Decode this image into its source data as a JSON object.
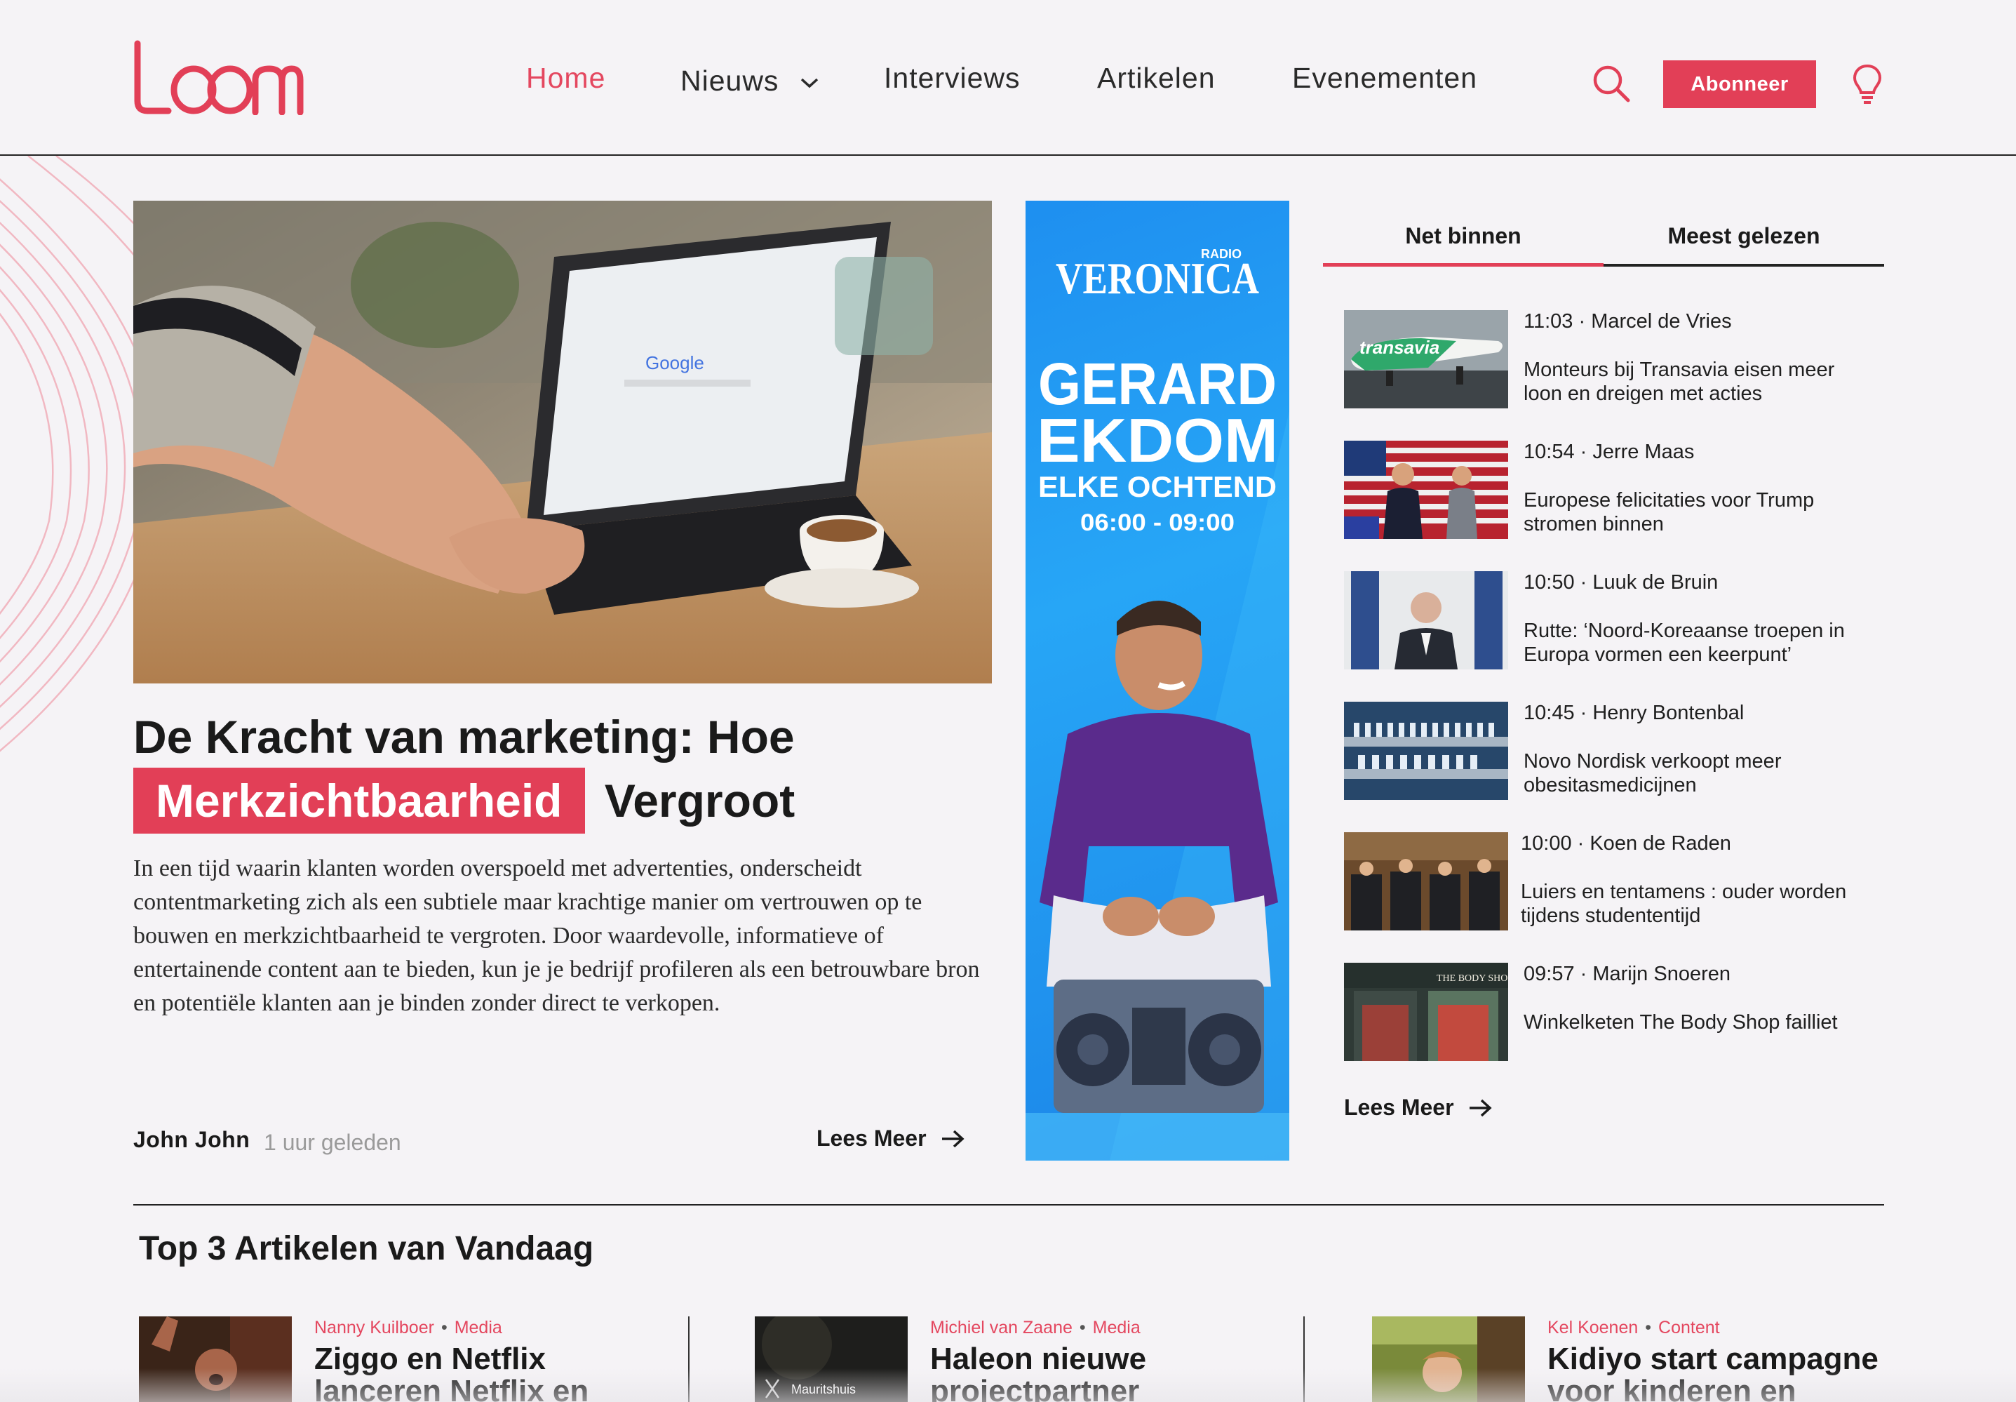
{
  "brand": {
    "name": "loom",
    "accent": "#e23f57"
  },
  "nav": {
    "items": [
      {
        "label": "Home",
        "active": true
      },
      {
        "label": "Nieuws",
        "dropdown": true
      },
      {
        "label": "Interviews"
      },
      {
        "label": "Artikelen"
      },
      {
        "label": "Evenementen"
      }
    ],
    "subscribe_label": "Abonneer",
    "icons": [
      "search-icon",
      "lightbulb-icon"
    ]
  },
  "hero": {
    "image": "laptop-google-coffee-photo",
    "title_part1": "De Kracht van marketing: Hoe",
    "title_highlight": "Merkzichtbaarheid",
    "title_part2": "Vergroot",
    "excerpt": "In een tijd waarin klanten worden overspoeld met advertenties, onderscheidt contentmarketing zich als een subtiele maar krachtige manier om vertrouwen op te bouwen en merkzichtbaarheid te vergroten. Door waardevolle, informatieve of entertainende content aan te bieden, kun je je bedrijf profileren als een betrouwbare bron en potentiële klanten aan je binden zonder direct te verkopen.",
    "author": "John John",
    "time_ago": "1 uur geleden",
    "read_more": "Lees Meer"
  },
  "ad": {
    "radio_label": "RADIO",
    "station": "VERONICA",
    "line1": "GERARD",
    "line2": "EKDOM",
    "line3": "ELKE OCHTEND",
    "time": "06:00 - 09:00"
  },
  "sidebar": {
    "tabs": [
      {
        "label": "Net binnen",
        "active": true
      },
      {
        "label": "Meest gelezen",
        "active": false
      }
    ],
    "items": [
      {
        "meta": "11:03 · Marcel de Vries",
        "title": "Monteurs bij Transavia eisen meer loon en dreigen met acties",
        "thumb": "airplane-photo",
        "thumb_text": "transavia"
      },
      {
        "meta": "10:54 · Jerre Maas",
        "title": "Europese felicitaties voor Trump stromen binnen",
        "thumb": "podium-flags-photo"
      },
      {
        "meta": "10:50 · Luuk de Bruin",
        "title": "Rutte: ‘Noord-Koreaanse troepen in Europa vormen een keerpunt’",
        "thumb": "press-conference-photo"
      },
      {
        "meta": "10:45 · Henry Bontenbal",
        "title": "Novo Nordisk verkoopt meer obesitasmedicijnen",
        "thumb": "factory-line-photo"
      },
      {
        "meta": "10:00 · Koen de Raden",
        "title": "Luiers en tentamens : ouder worden tijdens studententijd",
        "thumb": "exam-hall-photo"
      },
      {
        "meta": "09:57 · Marijn Snoeren",
        "title": "Winkelketen The Body Shop failliet",
        "thumb": "storefront-photo",
        "thumb_text": "THE BODY SHOP"
      }
    ],
    "read_more": "Lees Meer"
  },
  "top3": {
    "title": "Top 3 Artikelen van Vandaag",
    "cards": [
      {
        "author": "Nanny Kuilboer",
        "category": "Media",
        "title": "Ziggo en Netflix lanceren Netflix en",
        "thumb": "cheering-man-photo"
      },
      {
        "author": "Michiel van Zaane",
        "category": "Media",
        "title": "Haleon nieuwe projectpartner",
        "thumb": "mauritshuis-photo",
        "thumb_text": "Mauritshuis"
      },
      {
        "author": "Kel Koenen",
        "category": "Content",
        "title": "Kidiyo start campagne voor kinderen en",
        "thumb": "child-outdoors-photo"
      }
    ]
  }
}
